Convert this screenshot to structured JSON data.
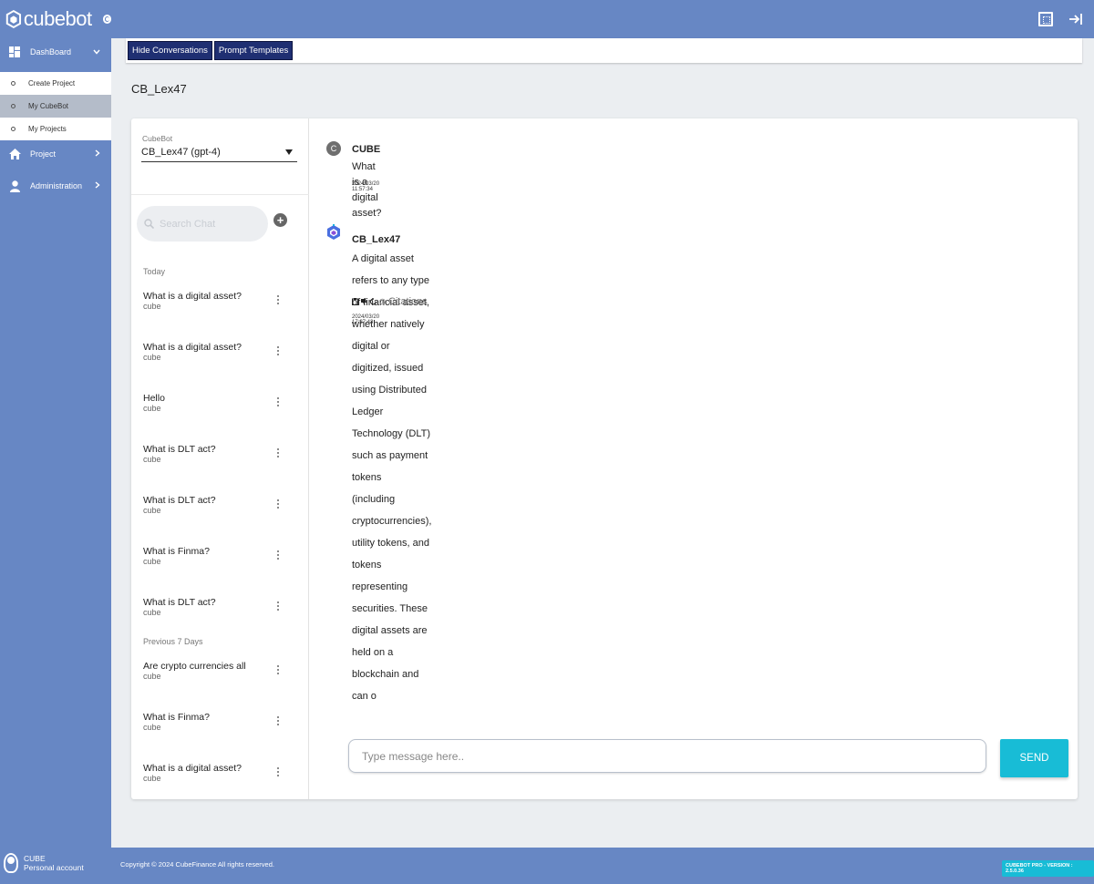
{
  "brand": {
    "name": "cubebot"
  },
  "sidebar": {
    "dashboard": "DashBoard",
    "sub_items": [
      {
        "label": "Create Project"
      },
      {
        "label": "My CubeBot"
      },
      {
        "label": "My Projects"
      }
    ],
    "project": "Project",
    "administration": "Administration",
    "user": {
      "name": "CUBE",
      "account": "Personal account"
    }
  },
  "toolbar": {
    "hide_conversations": "Hide Conversations",
    "prompt_templates": "Prompt Templates"
  },
  "page_title": "CB_Lex47",
  "bot_select": {
    "label": "CubeBot",
    "value": "CB_Lex47 (gpt-4)"
  },
  "search": {
    "placeholder": "Search Chat"
  },
  "conversations": {
    "today_label": "Today",
    "today": [
      {
        "title": "What is a digital asset?",
        "sub": "cube"
      },
      {
        "title": "What is a digital asset?",
        "sub": "cube"
      },
      {
        "title": "Hello",
        "sub": "cube"
      },
      {
        "title": "What is DLT act?",
        "sub": "cube"
      },
      {
        "title": "What is DLT act?",
        "sub": "cube"
      },
      {
        "title": "What is Finma?",
        "sub": "cube"
      },
      {
        "title": "What is DLT act?",
        "sub": "cube"
      }
    ],
    "prev_label": "Previous 7 Days",
    "previous": [
      {
        "title": "Are crypto currencies all",
        "sub": "cube"
      },
      {
        "title": "What is Finma?",
        "sub": "cube"
      },
      {
        "title": "What is a digital asset?",
        "sub": "cube"
      }
    ]
  },
  "messages": [
    {
      "avatar": "C",
      "author": "CUBE",
      "text": "What is a digital asset?",
      "time": "2024/03/20 11:57:34"
    },
    {
      "author": "CB_Lex47",
      "line1": "A digital asset refers to any type of financial asset, whether natively digital or digitized, issued using Distributed Ledger Technology (DLT) such as payment tokens",
      "line2": "(including cryptocurrencies), utility tokens, and tokens representing securities. These digital assets are held on a blockchain and can o",
      "citations": "Citations",
      "time": "2024/03/20 17:27:42"
    }
  ],
  "composer": {
    "placeholder": "Type message here..",
    "send": "SEND"
  },
  "footer": {
    "copyright": "Copyright © 2024 CubeFinance All rights reserved.",
    "version": "CUBEBOT PRO - VERSION : 2.5.0.36"
  },
  "colors": {
    "primary": "#6787c4",
    "accent": "#18bcd6",
    "toolbar_button": "#1f2f72"
  }
}
